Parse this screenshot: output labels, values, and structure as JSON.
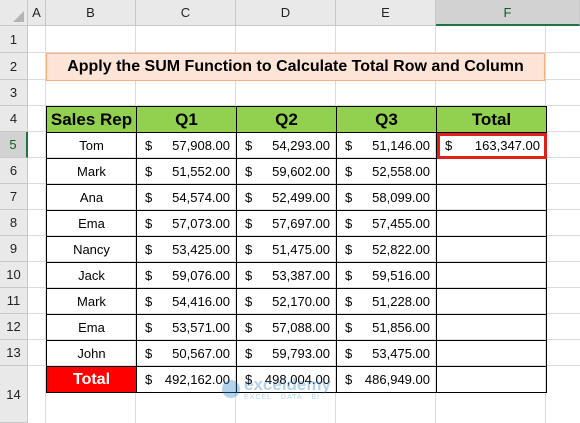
{
  "columns": [
    "A",
    "B",
    "C",
    "D",
    "E",
    "F"
  ],
  "rows": [
    "1",
    "2",
    "3",
    "4",
    "5",
    "6",
    "7",
    "8",
    "9",
    "10",
    "11",
    "12",
    "13",
    "14"
  ],
  "active_column": "F",
  "active_row": "5",
  "title": "Apply the SUM Function to Calculate Total Row and Column",
  "table": {
    "headers": [
      "Sales Rep",
      "Q1",
      "Q2",
      "Q3",
      "Total"
    ],
    "currency_symbol": "$",
    "rows": [
      {
        "name": "Tom",
        "q1": "57,908.00",
        "q2": "54,293.00",
        "q3": "51,146.00",
        "total": "163,347.00"
      },
      {
        "name": "Mark",
        "q1": "51,552.00",
        "q2": "59,602.00",
        "q3": "52,558.00",
        "total": ""
      },
      {
        "name": "Ana",
        "q1": "54,574.00",
        "q2": "52,499.00",
        "q3": "58,099.00",
        "total": ""
      },
      {
        "name": "Ema",
        "q1": "57,073.00",
        "q2": "57,697.00",
        "q3": "57,455.00",
        "total": ""
      },
      {
        "name": "Nancy",
        "q1": "53,425.00",
        "q2": "51,475.00",
        "q3": "52,822.00",
        "total": ""
      },
      {
        "name": "Jack",
        "q1": "59,076.00",
        "q2": "53,387.00",
        "q3": "59,516.00",
        "total": ""
      },
      {
        "name": "Mark",
        "q1": "54,416.00",
        "q2": "52,170.00",
        "q3": "51,228.00",
        "total": ""
      },
      {
        "name": "Ema",
        "q1": "53,571.00",
        "q2": "57,088.00",
        "q3": "51,856.00",
        "total": ""
      },
      {
        "name": "John",
        "q1": "50,567.00",
        "q2": "59,793.00",
        "q3": "53,475.00",
        "total": ""
      }
    ],
    "total_row": {
      "label": "Total",
      "q1": "492,162.00",
      "q2": "498,004.00",
      "q3": "486,949.00",
      "total": ""
    }
  },
  "watermark": {
    "name": "exceldemy",
    "tagline": "EXCEL · DATA · BI"
  },
  "colors": {
    "header_green": "#92d050",
    "title_fill": "#fce4d6",
    "total_red": "#ff0000",
    "selection": "#e0201b"
  }
}
